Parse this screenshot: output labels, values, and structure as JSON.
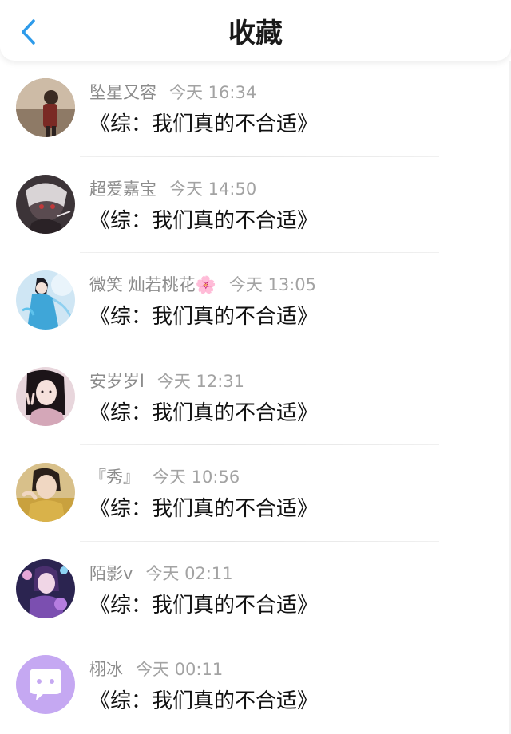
{
  "header": {
    "title": "收藏",
    "back_icon": "chevron-left-icon",
    "accent": "#2e9bea"
  },
  "items": [
    {
      "name": "坠星又容",
      "time": "今天 16:34",
      "message": "《综：我们真的不合适》",
      "avatar": "photo-person-standing"
    },
    {
      "name": "超爱嘉宝",
      "time": "今天 14:50",
      "message": "《综：我们真的不合适》",
      "avatar": "anime-character-dark"
    },
    {
      "name": "微笑 灿若桃花🌸",
      "time": "今天 13:05",
      "message": "《综：我们真的不合适》",
      "avatar": "illustration-blue-robed-figure"
    },
    {
      "name": "安岁岁l",
      "time": "今天 12:31",
      "message": "《综：我们真的不合适》",
      "avatar": "photo-woman-peace-sign"
    },
    {
      "name": "『秀』",
      "time": "今天 10:56",
      "message": "《综：我们真的不合适》",
      "avatar": "photo-person-yellow"
    },
    {
      "name": "陌影v",
      "time": "今天 02:11",
      "message": "《综：我们真的不合适》",
      "avatar": "anime-purple-girl"
    },
    {
      "name": "栩冰",
      "time": "今天 00:11",
      "message": "《综：我们真的不合适》",
      "avatar": "default-chat-bubble-avatar"
    }
  ]
}
